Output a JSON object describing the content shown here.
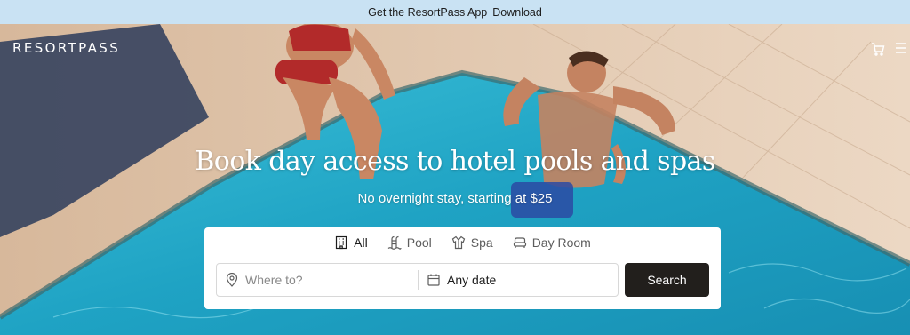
{
  "promo": {
    "text": "Get the ResortPass App",
    "link": "Download"
  },
  "header": {
    "logo": "RESORTPASS",
    "cart_icon": "cart-icon",
    "menu_icon": "hamburger-menu-icon"
  },
  "hero": {
    "headline": "Book day access to hotel pools and spas",
    "subline": "No overnight stay, starting at $25"
  },
  "search": {
    "tabs": [
      {
        "label": "All",
        "icon": "building-icon",
        "active": true
      },
      {
        "label": "Pool",
        "icon": "pool-ladder-icon",
        "active": false
      },
      {
        "label": "Spa",
        "icon": "spa-robe-icon",
        "active": false
      },
      {
        "label": "Day Room",
        "icon": "bed-icon",
        "active": false
      }
    ],
    "where_placeholder": "Where to?",
    "date_value": "Any date",
    "button_label": "Search"
  },
  "colors": {
    "promo_bg": "#c9e2f3",
    "button": "#221f1c",
    "pool": "#24a9c6",
    "deck": "#e6cdb6"
  }
}
